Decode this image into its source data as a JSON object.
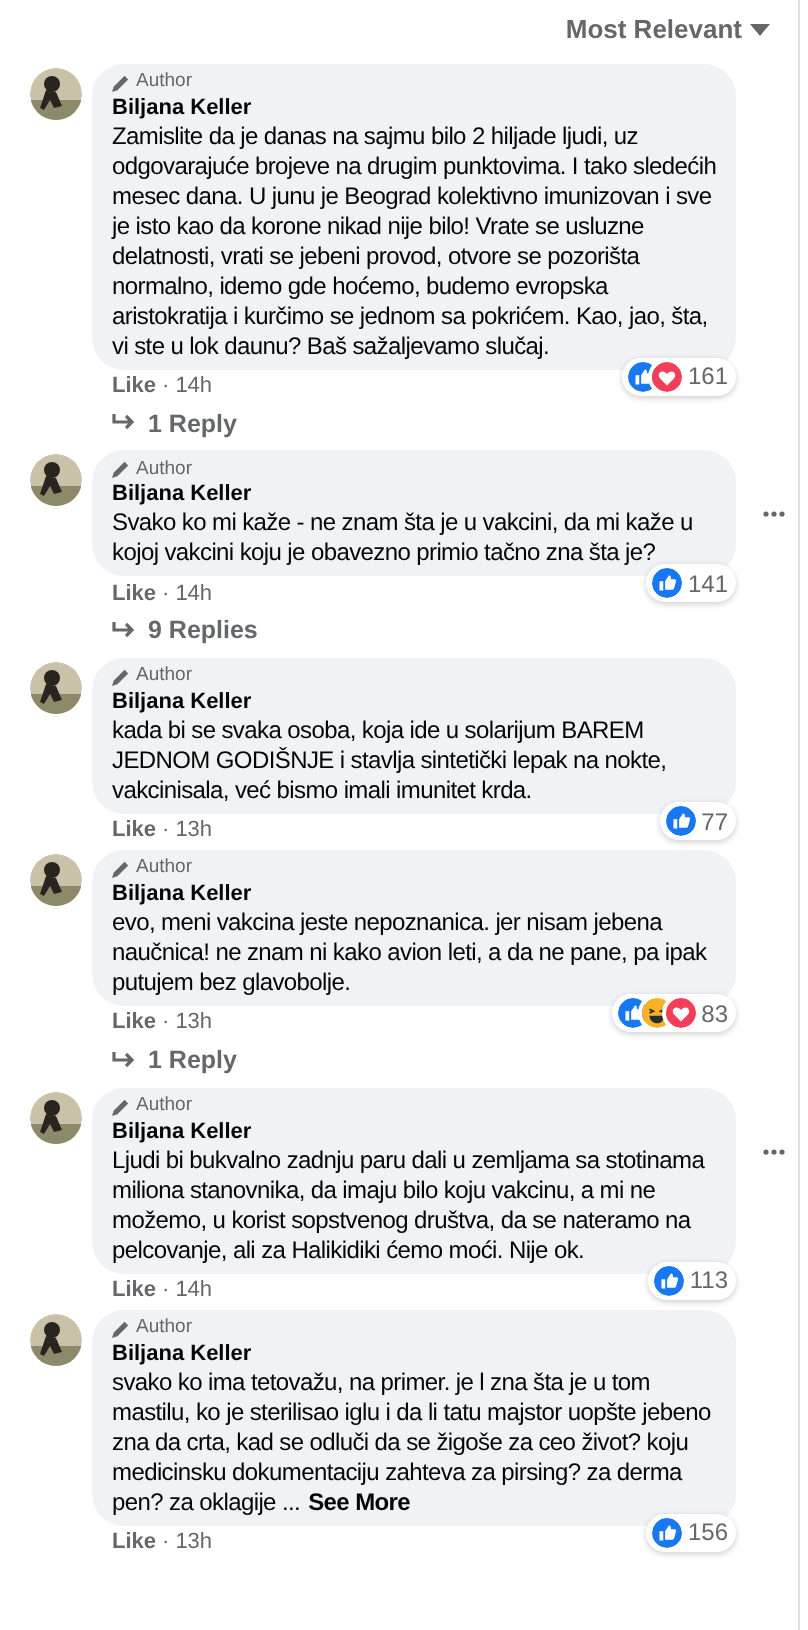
{
  "sort": {
    "label": "Most Relevant"
  },
  "comments": [
    {
      "badge": "Author",
      "name": "Biljana Keller",
      "text": "Zamislite da je danas na sajmu bilo 2 hiljade ljudi, uz odgovarajuće brojeve na drugim punktovima. I tako sledećih mesec dana. U junu je Beograd kolektivno imunizovan i sve je isto kao da korone nikad nije bilo! Vrate se usluzne delatnosti, vrati se jebeni provod, otvore se pozorišta normalno, idemo gde hoćemo, budemo evropska aristokratija i kurčimo se jednom sa pokrićem. Kao, jao, šta, vi ste u lok daunu? Baš sažaljevamo slučaj.",
      "reactions": [
        {
          "kind": "like"
        },
        {
          "kind": "love"
        }
      ],
      "count": "161",
      "like": "Like",
      "separator": "·",
      "time": "14h",
      "replies": "1 Reply",
      "menu": false
    },
    {
      "badge": "Author",
      "name": "Biljana Keller",
      "text": "Svako ko mi kaže - ne znam šta je u vakcini, da mi kaže u kojoj vakcini koju je obavezno primio tačno zna šta je?",
      "reactions": [
        {
          "kind": "like"
        }
      ],
      "count": "141",
      "like": "Like",
      "separator": "·",
      "time": "14h",
      "replies": "9 Replies",
      "menu": true
    },
    {
      "badge": "Author",
      "name": "Biljana Keller",
      "text": "kada bi se svaka osoba, koja ide u solarijum BAREM JEDNOM GODIŠNJE i stavlja sintetički lepak na nokte, vakcinisala, već bismo imali imunitet krda.",
      "reactions": [
        {
          "kind": "like"
        }
      ],
      "count": "77",
      "like": "Like",
      "separator": "·",
      "time": "13h",
      "menu": false
    },
    {
      "badge": "Author",
      "name": "Biljana Keller",
      "text": "evo, meni vakcina jeste nepoznanica. jer nisam jebena naučnica! ne znam ni kako avion leti, a da ne pane, pa ipak putujem bez glavobolje.",
      "reactions": [
        {
          "kind": "like"
        },
        {
          "kind": "haha"
        },
        {
          "kind": "love"
        }
      ],
      "count": "83",
      "like": "Like",
      "separator": "·",
      "time": "13h",
      "replies": "1 Reply",
      "menu": false
    },
    {
      "badge": "Author",
      "name": "Biljana Keller",
      "text": "Ljudi bi bukvalno zadnju paru dali u zemljama sa stotinama miliona stanovnika, da imaju bilo koju vakcinu, a mi ne možemo, u korist sopstvenog društva, da se nateramo na pelcovanje, ali za Halikidiki ćemo moći. Nije ok.",
      "reactions": [
        {
          "kind": "like"
        }
      ],
      "count": "113",
      "like": "Like",
      "separator": "·",
      "time": "14h",
      "menu": true
    },
    {
      "badge": "Author",
      "name": "Biljana Keller",
      "text": "svako ko ima tetovažu, na primer. je l zna šta je u tom mastilu, ko je sterilisao iglu i da li tatu majstor uopšte jebeno zna da crta, kad se odluči da se žigoše za ceo život? koju medicinsku dokumentaciju zahteva za pirsing? za derma pen? za oklagije ...",
      "more": "See More",
      "reactions": [
        {
          "kind": "like"
        }
      ],
      "count": "156",
      "like": "Like",
      "separator": "·",
      "time": "13h",
      "menu": false
    }
  ]
}
